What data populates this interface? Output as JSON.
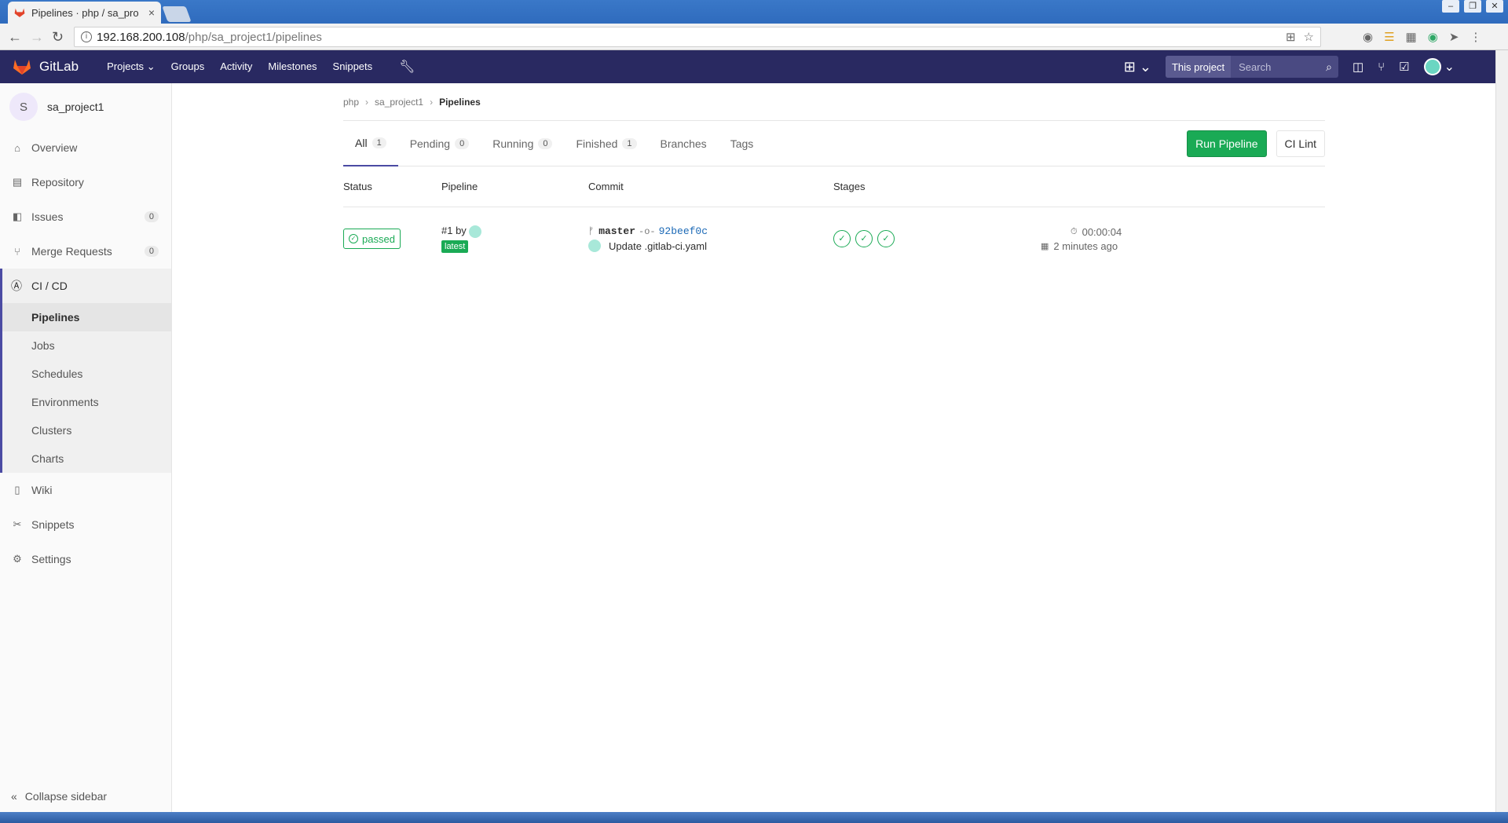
{
  "browser": {
    "tab_title": "Pipelines · php / sa_pro",
    "tab_close": "×",
    "url_host": "192.168.200.108",
    "url_path": "/php/sa_project1/pipelines"
  },
  "header": {
    "brand": "GitLab",
    "nav": [
      "Projects",
      "Groups",
      "Activity",
      "Milestones",
      "Snippets"
    ],
    "search_scope": "This project",
    "search_placeholder": "Search"
  },
  "sidebar": {
    "project_initial": "S",
    "project_name": "sa_project1",
    "items": [
      {
        "label": "Overview"
      },
      {
        "label": "Repository"
      },
      {
        "label": "Issues",
        "count": "0"
      },
      {
        "label": "Merge Requests",
        "count": "0"
      }
    ],
    "cicd": {
      "label": "CI / CD",
      "sub": [
        "Pipelines",
        "Jobs",
        "Schedules",
        "Environments",
        "Clusters",
        "Charts"
      ]
    },
    "bottom_items": [
      {
        "label": "Wiki"
      },
      {
        "label": "Snippets"
      },
      {
        "label": "Settings"
      }
    ],
    "collapse_label": "Collapse sidebar"
  },
  "breadcrumb": {
    "items": [
      "php",
      "sa_project1"
    ],
    "current": "Pipelines"
  },
  "tabs": [
    {
      "label": "All",
      "count": "1"
    },
    {
      "label": "Pending",
      "count": "0"
    },
    {
      "label": "Running",
      "count": "0"
    },
    {
      "label": "Finished",
      "count": "1"
    },
    {
      "label": "Branches"
    },
    {
      "label": "Tags"
    }
  ],
  "actions": {
    "run_pipeline": "Run Pipeline",
    "ci_lint": "CI Lint"
  },
  "table": {
    "headers": [
      "Status",
      "Pipeline",
      "Commit",
      "Stages"
    ],
    "rows": [
      {
        "status": "passed",
        "pipeline_id": "#1 by",
        "latest": "latest",
        "branch": "master",
        "sha": "92beef0c",
        "message": "Update .gitlab-ci.yaml",
        "duration": "00:00:04",
        "finished": "2 minutes ago"
      }
    ]
  },
  "colors": {
    "header_bg": "#292961",
    "success": "#1aaa55",
    "link": "#1b69b6"
  }
}
